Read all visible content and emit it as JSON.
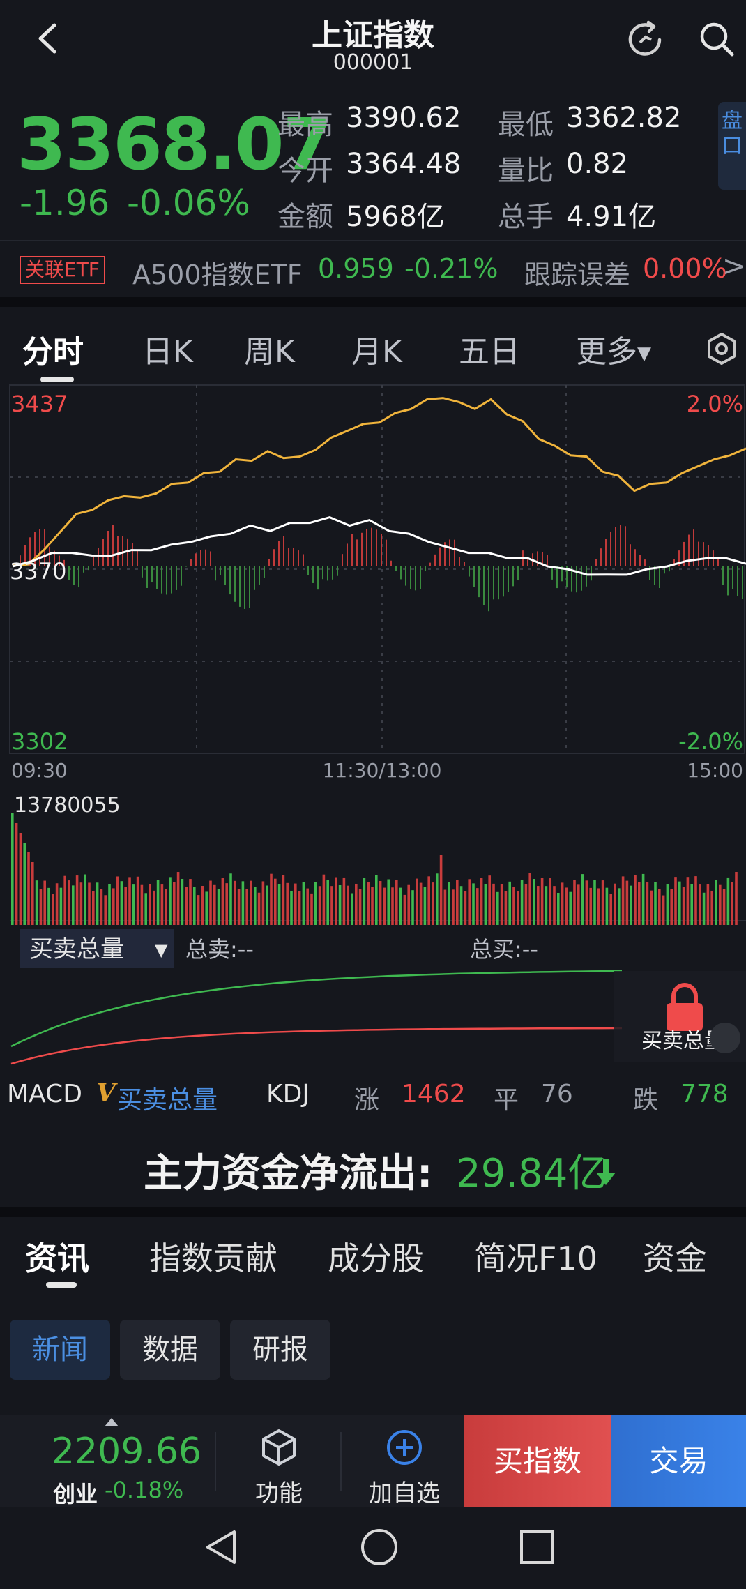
{
  "header": {
    "title": "上证指数",
    "code": "000001"
  },
  "quote": {
    "price": "3368.07",
    "change": "-1.96",
    "change_pct": "-0.06%",
    "stats": [
      {
        "label": "最高",
        "value": "3390.62"
      },
      {
        "label": "最低",
        "value": "3362.82"
      },
      {
        "label": "今开",
        "value": "3364.48"
      },
      {
        "label": "量比",
        "value": "0.82"
      },
      {
        "label": "金额",
        "value": "5968亿"
      },
      {
        "label": "总手",
        "value": "4.91亿"
      }
    ],
    "side_tab": "盘口"
  },
  "etf": {
    "badge": "关联ETF",
    "name": "A500指数ETF",
    "price": "0.959",
    "pct": "-0.21%",
    "tracking_label": "跟踪误差",
    "tracking_value": "0.00%",
    "chevron": ">"
  },
  "kline_tabs": [
    "分时",
    "日K",
    "周K",
    "月K",
    "五日",
    "更多"
  ],
  "chart_labels": {
    "y_top": "3437",
    "y_mid": "3370",
    "y_bottom": "3302",
    "pct_top": "2.0%",
    "pct_bottom": "-2.0%",
    "x_start": "09:30",
    "x_mid": "11:30/13:00",
    "x_end": "15:00",
    "vol_max": "13780055",
    "bs_selector": "买卖总量",
    "total_sell": "总卖:--",
    "total_buy": "总买:--",
    "lock_label": "买卖总量"
  },
  "chart_data": {
    "type": "line",
    "x": [
      "09:30",
      "11:30/13:00",
      "15:00"
    ],
    "ylim": [
      3302,
      3437
    ],
    "series": [],
    "price_points": [
      3370,
      3372,
      3376,
      3384,
      3389,
      3392,
      3394,
      3397,
      3395,
      3398,
      3400,
      3402,
      3404,
      3406,
      3409,
      3410,
      3412,
      3411,
      3410,
      3414,
      3417,
      3421,
      3422,
      3424,
      3426,
      3429,
      3431,
      3433,
      3430,
      3429,
      3431,
      3427,
      3423,
      3418,
      3414,
      3412,
      3410,
      3406,
      3403,
      3399,
      3400,
      3402,
      3404,
      3408,
      3409,
      3412,
      3413
    ],
    "avg_points": [
      3370,
      3373,
      3375,
      3376,
      3374,
      3375,
      3376,
      3377,
      3378,
      3380,
      3381,
      3383,
      3385,
      3384,
      3386,
      3387,
      3388,
      3386,
      3387,
      3384,
      3382,
      3380,
      3377,
      3376,
      3375,
      3374,
      3373,
      3371,
      3369,
      3368,
      3367,
      3368,
      3369,
      3371,
      3372,
      3374,
      3373,
      3372
    ],
    "net_flow_series": "up-down bars around zero line"
  },
  "indicator_row": {
    "items": [
      "MACD",
      "买卖总量",
      "KDJ"
    ],
    "rise_label": "涨",
    "rise": "1462",
    "flat_label": "平",
    "flat": "76",
    "fall_label": "跌",
    "fall": "778"
  },
  "flow": {
    "label": "主力资金净流出:",
    "value": "29.84亿"
  },
  "news_tabs": [
    "资讯",
    "指数贡献",
    "成分股",
    "简况F10",
    "资金"
  ],
  "news_chips": [
    "新闻",
    "数据",
    "研报"
  ],
  "bottom": {
    "index_value": "2209.66",
    "index_name": "创业",
    "index_pct": "-0.18%",
    "func_label": "功能",
    "add_label": "加自选",
    "buy_label": "买指数",
    "trade_label": "交易"
  },
  "colors": {
    "up": "#ef4b4b",
    "down": "#3fb950",
    "price_line": "#f0b43c",
    "avg_line": "#ffffff",
    "accent": "#3a82e8"
  }
}
